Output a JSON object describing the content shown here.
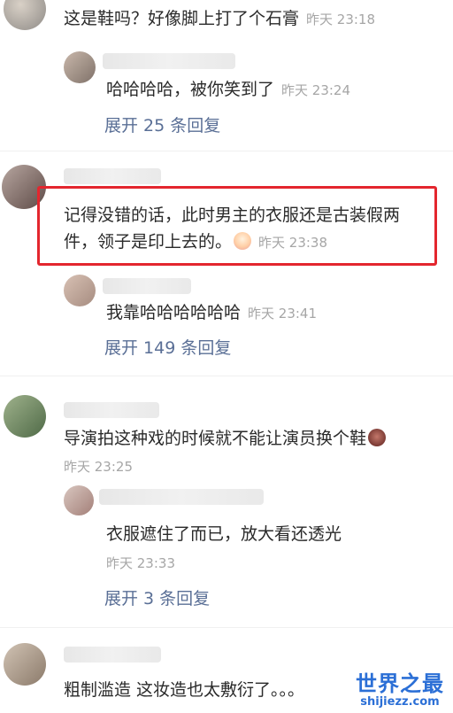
{
  "comments": [
    {
      "text": "这是鞋吗？好像脚上打了个石膏",
      "time": "昨天 23:18",
      "reply": {
        "text": "哈哈哈哈，被你笑到了",
        "time": "昨天 23:24"
      },
      "expand": "展开 25 条回复"
    },
    {
      "text_line1": "记得没错的话，此时男主的衣服还是古装假两",
      "text_line2": "件，领子是印上去的。",
      "emoji": "crying-laugh-icon",
      "time": "昨天 23:38",
      "reply": {
        "text": "我靠哈哈哈哈哈哈",
        "time": "昨天 23:41"
      },
      "expand": "展开 149 条回复"
    },
    {
      "text": "导演拍这种戏的时候就不能让演员换个鞋",
      "emoji": "angry-face-icon",
      "time": "昨天 23:25",
      "reply": {
        "text": "衣服遮住了而已，放大看还透光",
        "time": "昨天 23:33"
      },
      "expand": "展开 3 条回复"
    },
    {
      "text": "粗制滥造 这妆造也太敷衍了。。。"
    }
  ],
  "watermark": {
    "title": "世界之最",
    "url": "shijiezz.com"
  },
  "colors": {
    "highlight_border": "#e3262e",
    "link": "#5a6f96",
    "time": "#a6a6a6"
  }
}
